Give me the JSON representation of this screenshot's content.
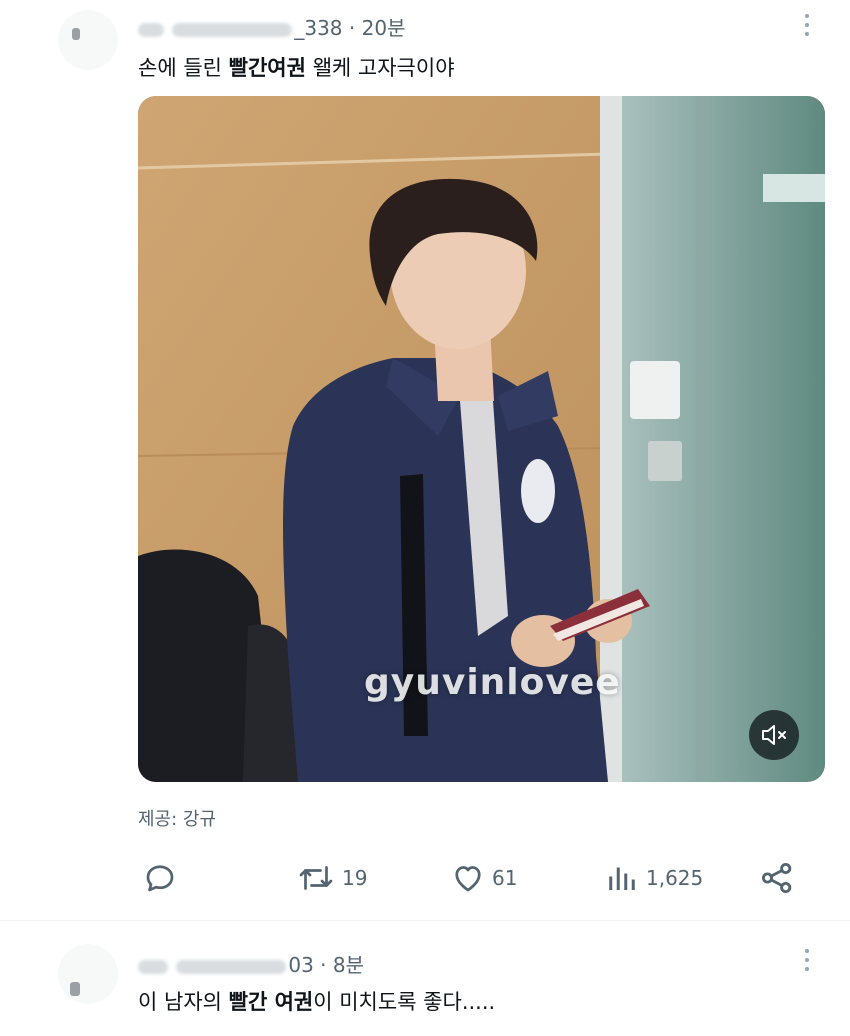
{
  "tweet1": {
    "handle_suffix": "_338",
    "separator": "·",
    "time": "20분",
    "text_before": "손에 들린 ",
    "text_bold": "빨간여권",
    "text_after": " 왤케 고자극이야",
    "media_watermark": "gyuvinlovee",
    "caption": "제공: 강규",
    "actions": {
      "retweets": "19",
      "likes": "61",
      "views": "1,625"
    },
    "icons": [
      "reply-icon",
      "retweet-icon",
      "heart-icon",
      "views-icon",
      "share-icon",
      "mute-icon",
      "more-icon"
    ]
  },
  "tweet2": {
    "handle_suffix": "03",
    "separator": "·",
    "time": "8분",
    "text_before": "이 남자의 ",
    "text_bold": "빨간 여권",
    "text_after": "이 미치도록 좋다.....",
    "icons": [
      "more-icon"
    ]
  }
}
